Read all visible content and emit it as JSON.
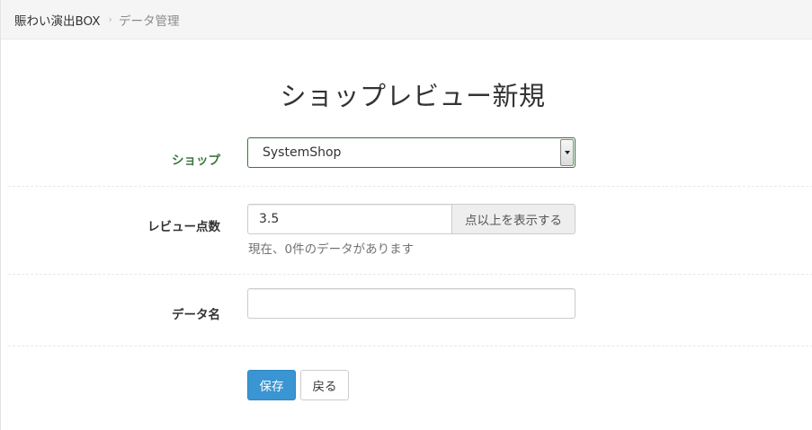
{
  "breadcrumb": {
    "home": "賑わい演出BOX",
    "separator": "›",
    "current": "データ管理"
  },
  "page": {
    "title": "ショップレビュー新規"
  },
  "form": {
    "shop": {
      "label": "ショップ",
      "selected_value": "SystemShop"
    },
    "score": {
      "label": "レビュー点数",
      "value": "3.5",
      "addon": "点以上を表示する",
      "help": "現在、0件のデータがあります"
    },
    "data_name": {
      "label": "データ名",
      "value": ""
    }
  },
  "actions": {
    "save_label": "保存",
    "back_label": "戻る"
  },
  "colors": {
    "primary": "#3a95d2",
    "success_label": "#3c763d",
    "breadcrumb_bg": "#f5f5f5"
  },
  "icons": {
    "breadcrumb_separator": "chevron-right-icon",
    "select_arrow": "caret-down-icon"
  }
}
